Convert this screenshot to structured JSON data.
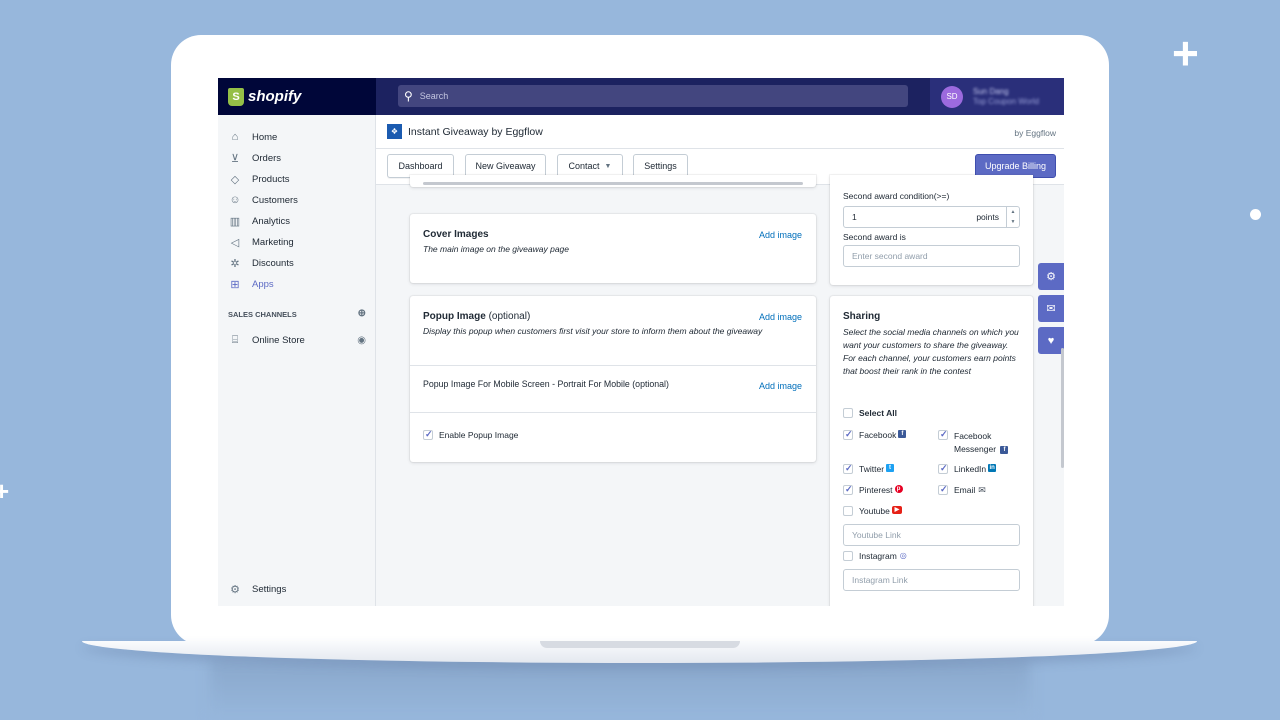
{
  "brand": {
    "name": "shopify",
    "logo_letter": "S"
  },
  "search": {
    "placeholder": "Search"
  },
  "user": {
    "initials": "SD",
    "name": "Sun Dang",
    "store": "Top Coupon World"
  },
  "nav": {
    "items": [
      {
        "label": "Home",
        "icon": "home-icon"
      },
      {
        "label": "Orders",
        "icon": "orders-icon"
      },
      {
        "label": "Products",
        "icon": "tag-icon"
      },
      {
        "label": "Customers",
        "icon": "person-icon"
      },
      {
        "label": "Analytics",
        "icon": "bar-chart-icon"
      },
      {
        "label": "Marketing",
        "icon": "megaphone-icon"
      },
      {
        "label": "Discounts",
        "icon": "discount-icon"
      },
      {
        "label": "Apps",
        "icon": "apps-icon",
        "active": true
      }
    ],
    "sales_channels_label": "SALES CHANNELS",
    "online_store_label": "Online Store",
    "settings_label": "Settings"
  },
  "app": {
    "title": "Instant Giveaway by Eggflow",
    "by": "by Eggflow"
  },
  "tabs": {
    "dashboard": "Dashboard",
    "new_giveaway": "New Giveaway",
    "contact": "Contact",
    "settings": "Settings",
    "upgrade": "Upgrade Billing"
  },
  "cover": {
    "title": "Cover Images",
    "subtitle": "The main image on the giveaway page",
    "add": "Add image"
  },
  "popup": {
    "title": "Popup Image",
    "optional": "(optional)",
    "subtitle": "Display this popup when customers first visit your store to inform them about the giveaway",
    "add": "Add image",
    "mobile_label": "Popup Image For Mobile Screen - Portrait For Mobile (optional)",
    "mobile_add": "Add image",
    "enable_label": "Enable Popup Image",
    "enable_checked": true
  },
  "award": {
    "condition_label": "Second award condition(>=)",
    "condition_value": "1",
    "condition_unit": "points",
    "award_label": "Second award is",
    "award_placeholder": "Enter second award"
  },
  "sharing": {
    "title": "Sharing",
    "description": "Select the social media channels on which you want your customers to share the giveaway. For each channel, your customers earn points that boost their rank in the contest",
    "select_all": "Select All",
    "facebook": "Facebook",
    "messenger_line1": "Facebook",
    "messenger_line2": "Messenger",
    "twitter": "Twitter",
    "linkedin": "LinkedIn",
    "pinterest": "Pinterest",
    "email": "Email",
    "youtube": "Youtube",
    "youtube_placeholder": "Youtube Link",
    "instagram": "Instagram",
    "instagram_placeholder": "Instagram Link"
  },
  "colors": {
    "accent": "#5c6ac4",
    "topbar": "#1c2260",
    "link": "#006fbb",
    "background": "#97b7dc"
  }
}
